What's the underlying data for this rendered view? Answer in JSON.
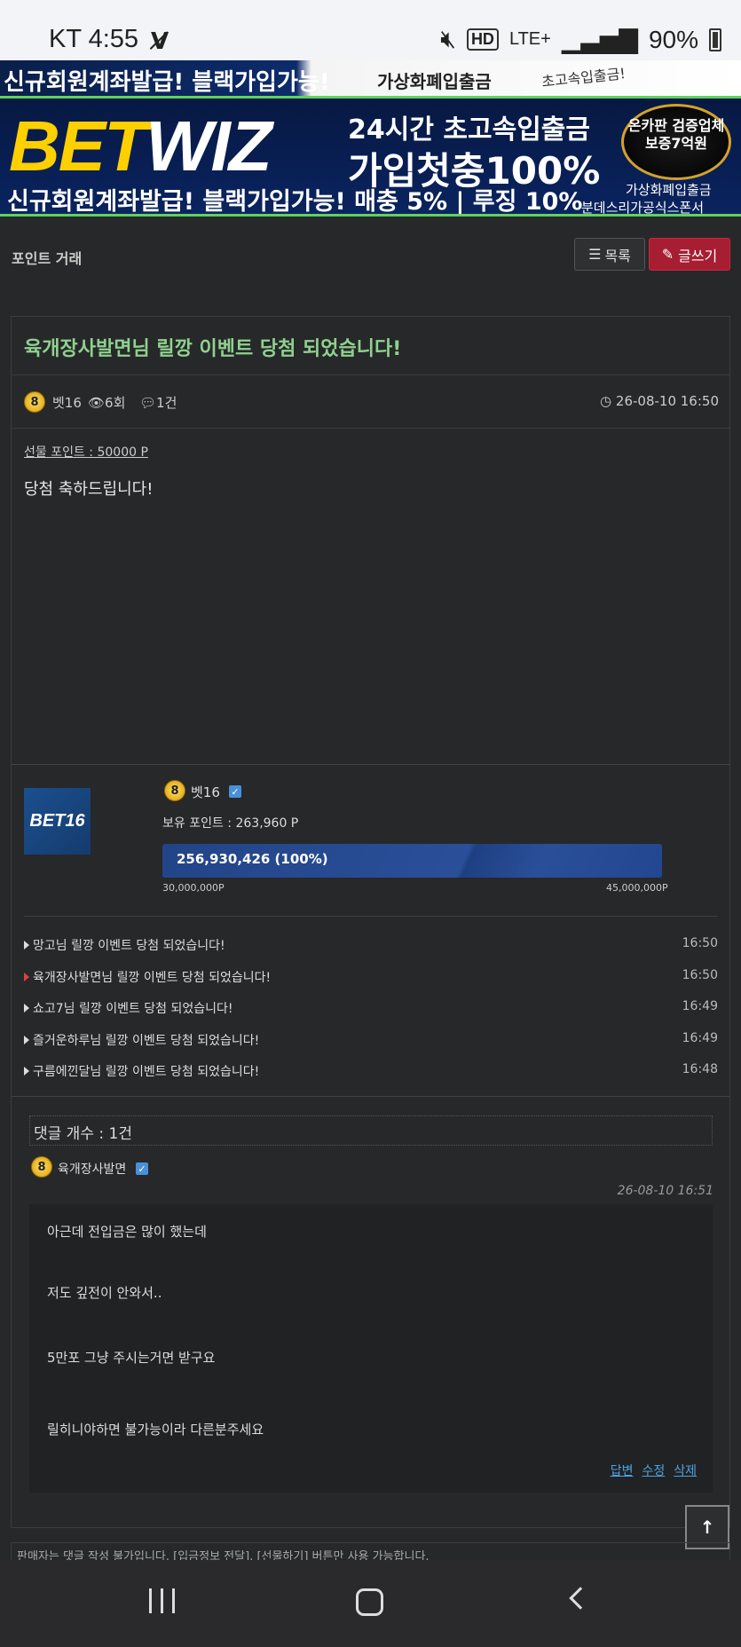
{
  "status": {
    "carrier_time": "KT 4:55",
    "network": "LTE+",
    "battery": "90%",
    "hd": "HD"
  },
  "banner": {
    "top_line": "신규회원계좌발급! 블랙가입가능!",
    "top_crypto": "가상화폐입출금",
    "top_fast": "초고속입출금!",
    "brand_a": "BET",
    "brand_b": "WIZ",
    "line1": "24시간 초고속입출금",
    "line2": "가입첫충100%",
    "line3": "신규회원계좌발급! 블랙가입가능! 매충 5% | 루징 10%",
    "badge": "온카판 검증업체 보증7억원",
    "crypto": "가상화폐입출금",
    "sponsor": "분데스리가공식스폰서"
  },
  "board": {
    "title": "포인트 거래",
    "list_button": "목록",
    "write_button": "글쓰기"
  },
  "post": {
    "title": "육개장사발면님 릴깡 이벤트 당첨 되었습니다!",
    "level": "8",
    "author": "벳16",
    "views": "6회",
    "comments": "1건",
    "date": "26-08-10 16:50",
    "gift_points": "선물 포인트 : 50000 P",
    "body": "당첨 축하드립니다!"
  },
  "profile": {
    "avatar_text": "BET16",
    "level": "8",
    "name": "벳16",
    "points": "보유 포인트 : 263,960 P",
    "bar_text": "256,930,426 (100%)",
    "progress_fraction": 1.0,
    "bar_min": "30,000,000P",
    "bar_max": "45,000,000P"
  },
  "related": [
    {
      "title": "망고님 릴깡 이벤트 당첨 되었습니다!",
      "time": "16:50",
      "current": false
    },
    {
      "title": "육개장사발면님 릴깡 이벤트 당첨 되었습니다!",
      "time": "16:50",
      "current": true
    },
    {
      "title": "쇼고7님 릴깡 이벤트 당첨 되었습니다!",
      "time": "16:49",
      "current": false
    },
    {
      "title": "즐거운하루님 릴깡 이벤트 당첨 되었습니다!",
      "time": "16:49",
      "current": false
    },
    {
      "title": "구름에낀달님 릴깡 이벤트 당첨 되었습니다!",
      "time": "16:48",
      "current": false
    }
  ],
  "comments": {
    "header": "댓글 개수 : 1건",
    "items": [
      {
        "level": "8",
        "author": "육개장사발면",
        "date": "26-08-10 16:51",
        "lines": [
          "아근데 전입금은 많이 했는데",
          "저도 깊전이 안와서..",
          "5만포 그냥 주시는거면 받구요",
          "릴히니야하면 불가능이라 다른분주세요"
        ],
        "actions": {
          "reply": "답변",
          "edit": "수정",
          "delete": "삭제"
        }
      }
    ]
  },
  "notice": "판매자는 댓글 작성 불가입니다. [입금정보 전달], [선물하기] 버튼만 사용 가능합니다."
}
